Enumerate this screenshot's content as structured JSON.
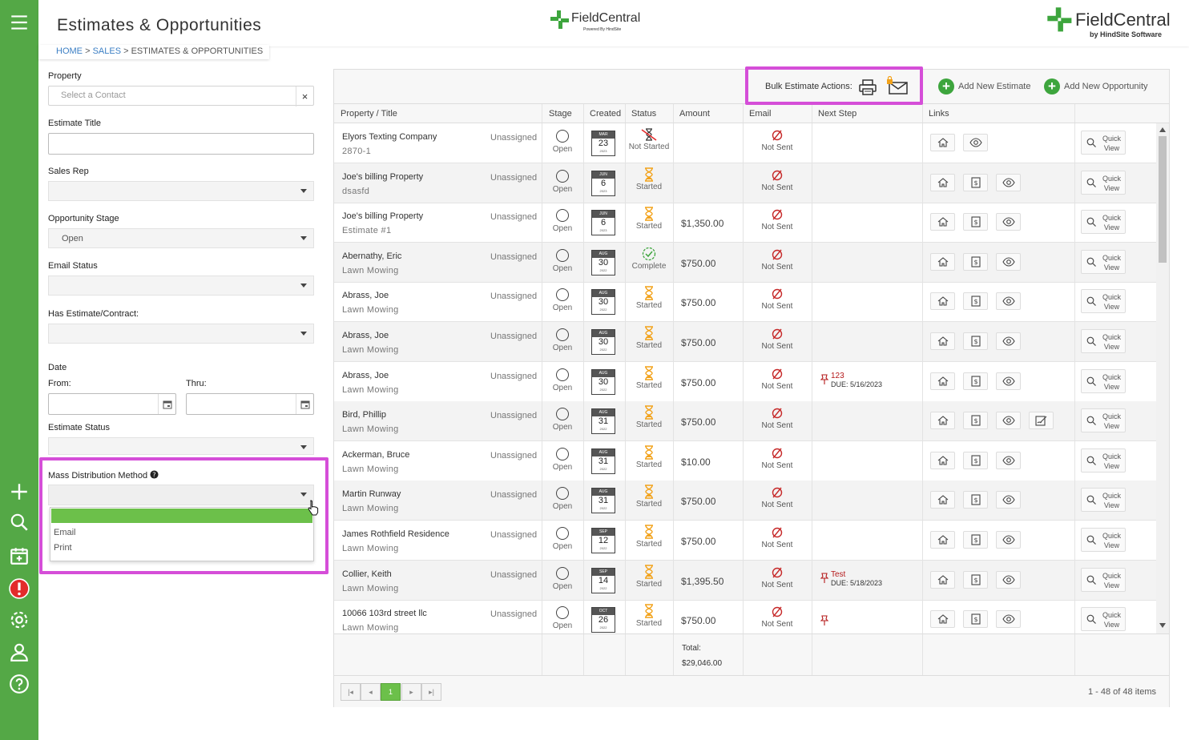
{
  "header": {
    "title": "Estimates & Opportunities",
    "logo_center_text": "FieldCentral",
    "logo_center_sub": "Powered By HindSite",
    "logo_right_text": "FieldCentral",
    "logo_right_sub": "by HindSite Software"
  },
  "breadcrumb": {
    "home": "HOME",
    "sales": "SALES",
    "current": "ESTIMATES & OPPORTUNITIES",
    "sep": ">"
  },
  "filters": {
    "property_label": "Property",
    "property_placeholder": "Select a Contact",
    "clear": "×",
    "estimate_title_label": "Estimate Title",
    "sales_rep_label": "Sales Rep",
    "opportunity_stage_label": "Opportunity Stage",
    "opportunity_stage_value": "Open",
    "email_status_label": "Email Status",
    "has_estimate_label": "Has Estimate/Contract:",
    "date_label": "Date",
    "from_label": "From:",
    "thru_label": "Thru:",
    "estimate_status_label": "Estimate Status",
    "mass_dist_label": "Mass Distribution Method",
    "mass_dist_options": [
      "",
      "Email",
      "Print"
    ]
  },
  "toolbar": {
    "bulk_label": "Bulk Estimate Actions:",
    "add_estimate": "Add New Estimate",
    "add_opportunity": "Add New Opportunity"
  },
  "columns": {
    "property": "Property / Title",
    "stage": "Stage",
    "created": "Created",
    "status": "Status",
    "amount": "Amount",
    "email": "Email",
    "next_step": "Next Step",
    "links": "Links"
  },
  "rows": [
    {
      "name": "Elyors Texting Company",
      "title": "2870-1",
      "assigned": "Unassigned",
      "stage": "Open",
      "month": "MAR",
      "day": "23",
      "year": "2023",
      "status": "Not Started",
      "status_icon": "not-started",
      "amount": "",
      "email": "Not Sent",
      "next": "",
      "due": "",
      "est_link": false,
      "extra_link": false
    },
    {
      "name": "Joe's billing Property",
      "title": "dsasfd",
      "assigned": "Unassigned",
      "stage": "Open",
      "month": "JUN",
      "day": "6",
      "year": "2023",
      "status": "Started",
      "status_icon": "started",
      "amount": "",
      "email": "Not Sent",
      "next": "",
      "due": "",
      "est_link": true,
      "extra_link": false
    },
    {
      "name": "Joe's billing Property",
      "title": "Estimate #1",
      "assigned": "Unassigned",
      "stage": "Open",
      "month": "JUN",
      "day": "6",
      "year": "2023",
      "status": "Started",
      "status_icon": "started",
      "amount": "$1,350.00",
      "email": "Not Sent",
      "next": "",
      "due": "",
      "est_link": true,
      "extra_link": false
    },
    {
      "name": "Abernathy, Eric",
      "title": "Lawn Mowing",
      "assigned": "Unassigned",
      "stage": "Open",
      "month": "AUG",
      "day": "30",
      "year": "2022",
      "status": "Complete",
      "status_icon": "complete",
      "amount": "$750.00",
      "email": "Not Sent",
      "next": "",
      "due": "",
      "est_link": true,
      "extra_link": false
    },
    {
      "name": "Abrass, Joe",
      "title": "Lawn Mowing",
      "assigned": "Unassigned",
      "stage": "Open",
      "month": "AUG",
      "day": "30",
      "year": "2022",
      "status": "Started",
      "status_icon": "started",
      "amount": "$750.00",
      "email": "Not Sent",
      "next": "",
      "due": "",
      "est_link": true,
      "extra_link": false
    },
    {
      "name": "Abrass, Joe",
      "title": "Lawn Mowing",
      "assigned": "Unassigned",
      "stage": "Open",
      "month": "AUG",
      "day": "30",
      "year": "2022",
      "status": "Started",
      "status_icon": "started",
      "amount": "$750.00",
      "email": "Not Sent",
      "next": "",
      "due": "",
      "est_link": true,
      "extra_link": false
    },
    {
      "name": "Abrass, Joe",
      "title": "Lawn Mowing",
      "assigned": "Unassigned",
      "stage": "Open",
      "month": "AUG",
      "day": "30",
      "year": "2022",
      "status": "Started",
      "status_icon": "started",
      "amount": "$750.00",
      "email": "Not Sent",
      "next": "123",
      "due": "DUE: 5/16/2023",
      "est_link": true,
      "extra_link": false
    },
    {
      "name": "Bird, Phillip",
      "title": "Lawn Mowing",
      "assigned": "Unassigned",
      "stage": "Open",
      "month": "AUG",
      "day": "31",
      "year": "2022",
      "status": "Started",
      "status_icon": "started",
      "amount": "$750.00",
      "email": "Not Sent",
      "next": "",
      "due": "",
      "est_link": true,
      "extra_link": true
    },
    {
      "name": "Ackerman, Bruce",
      "title": "Lawn Mowing",
      "assigned": "Unassigned",
      "stage": "Open",
      "month": "AUG",
      "day": "31",
      "year": "2022",
      "status": "Started",
      "status_icon": "started",
      "amount": "$10.00",
      "email": "Not Sent",
      "next": "",
      "due": "",
      "est_link": true,
      "extra_link": false
    },
    {
      "name": "Martin Runway",
      "title": "Lawn Mowing",
      "assigned": "Unassigned",
      "stage": "Open",
      "month": "AUG",
      "day": "31",
      "year": "2022",
      "status": "Started",
      "status_icon": "started",
      "amount": "$750.00",
      "email": "Not Sent",
      "next": "",
      "due": "",
      "est_link": true,
      "extra_link": false
    },
    {
      "name": "James Rothfield Residence",
      "title": "Lawn Mowing",
      "assigned": "Unassigned",
      "stage": "Open",
      "month": "SEP",
      "day": "12",
      "year": "2022",
      "status": "Started",
      "status_icon": "started",
      "amount": "$750.00",
      "email": "Not Sent",
      "next": "",
      "due": "",
      "est_link": true,
      "extra_link": false
    },
    {
      "name": "Collier, Keith",
      "title": "Lawn Mowing",
      "assigned": "Unassigned",
      "stage": "Open",
      "month": "SEP",
      "day": "14",
      "year": "2022",
      "status": "Started",
      "status_icon": "started",
      "amount": "$1,395.50",
      "email": "Not Sent",
      "next": "Test",
      "due": "DUE: 5/18/2023",
      "est_link": true,
      "extra_link": false
    },
    {
      "name": "10066 103rd street llc",
      "title": "Lawn Mowing",
      "assigned": "Unassigned",
      "stage": "Open",
      "month": "OCT",
      "day": "26",
      "year": "2022",
      "status": "Started",
      "status_icon": "started",
      "amount": "$750.00",
      "email": "Not Sent",
      "next": "",
      "due": "",
      "est_link": true,
      "extra_link": false
    }
  ],
  "quick_view": {
    "line1": "Quick",
    "line2": "View"
  },
  "footer": {
    "total_label": "Total:",
    "total_value": "$29,046.00"
  },
  "pager": {
    "current_page": "1",
    "info": "1 - 48 of 48 items"
  },
  "colors": {
    "brand_green": "#54a846",
    "highlight": "#d54ed8",
    "alert_red": "#e32b2b"
  }
}
